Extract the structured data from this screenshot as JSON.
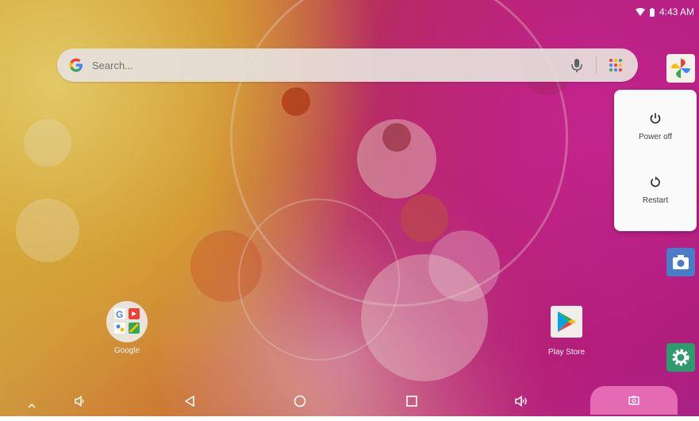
{
  "status_bar": {
    "time": "4:43 AM",
    "icons": [
      "wifi-icon",
      "battery-icon"
    ]
  },
  "search": {
    "placeholder": "Search...",
    "logo": "G"
  },
  "power_menu": {
    "items": [
      {
        "label": "Power off",
        "icon": "power-icon"
      },
      {
        "label": "Restart",
        "icon": "restart-icon"
      }
    ]
  },
  "apps": [
    {
      "label": "Google",
      "icon": "google-folder-icon"
    },
    {
      "label": "Play Store",
      "icon": "play-store-icon"
    }
  ],
  "side_apps": [
    "photos-icon",
    "camera-icon",
    "settings-icon"
  ],
  "nav_bar": [
    "expand-icon",
    "volume-down-icon",
    "back-icon",
    "home-icon",
    "recents-icon",
    "volume-up-icon",
    "screenshot-icon"
  ],
  "colors": {
    "accent_pink": "#e46ab4",
    "camera_blue": "#4a7cc7",
    "settings_green": "#2e9b6e"
  }
}
